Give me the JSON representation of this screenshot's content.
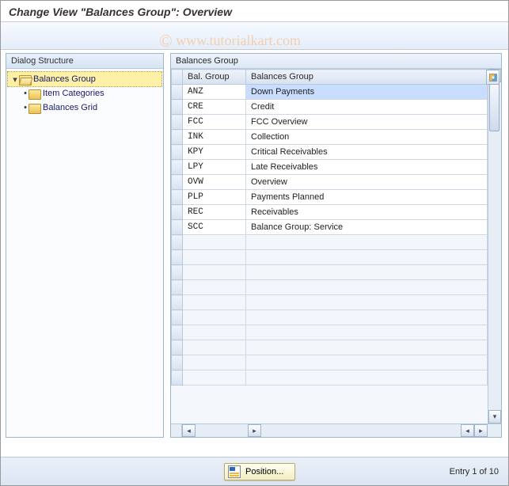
{
  "title": "Change View \"Balances Group\": Overview",
  "watermark": "www.tutorialkart.com",
  "tree": {
    "header": "Dialog Structure",
    "root": "Balances Group",
    "children": [
      "Item Categories",
      "Balances Grid"
    ]
  },
  "table": {
    "group_label": "Balances Group",
    "col1": "Bal. Group",
    "col2": "Balances Group",
    "rows": [
      {
        "code": "ANZ",
        "name": "Down Payments",
        "selected": true
      },
      {
        "code": "CRE",
        "name": "Credit"
      },
      {
        "code": "FCC",
        "name": "FCC Overview"
      },
      {
        "code": "INK",
        "name": "Collection"
      },
      {
        "code": "KPY",
        "name": "Critical Receivables"
      },
      {
        "code": "LPY",
        "name": "Late Receivables"
      },
      {
        "code": "OVW",
        "name": "Overview"
      },
      {
        "code": "PLP",
        "name": "Payments Planned"
      },
      {
        "code": "REC",
        "name": "Receivables"
      },
      {
        "code": "SCC",
        "name": "Balance Group: Service"
      }
    ],
    "empty_rows": 10
  },
  "footer": {
    "position_btn": "Position...",
    "entry_text": "Entry 1 of 10"
  }
}
